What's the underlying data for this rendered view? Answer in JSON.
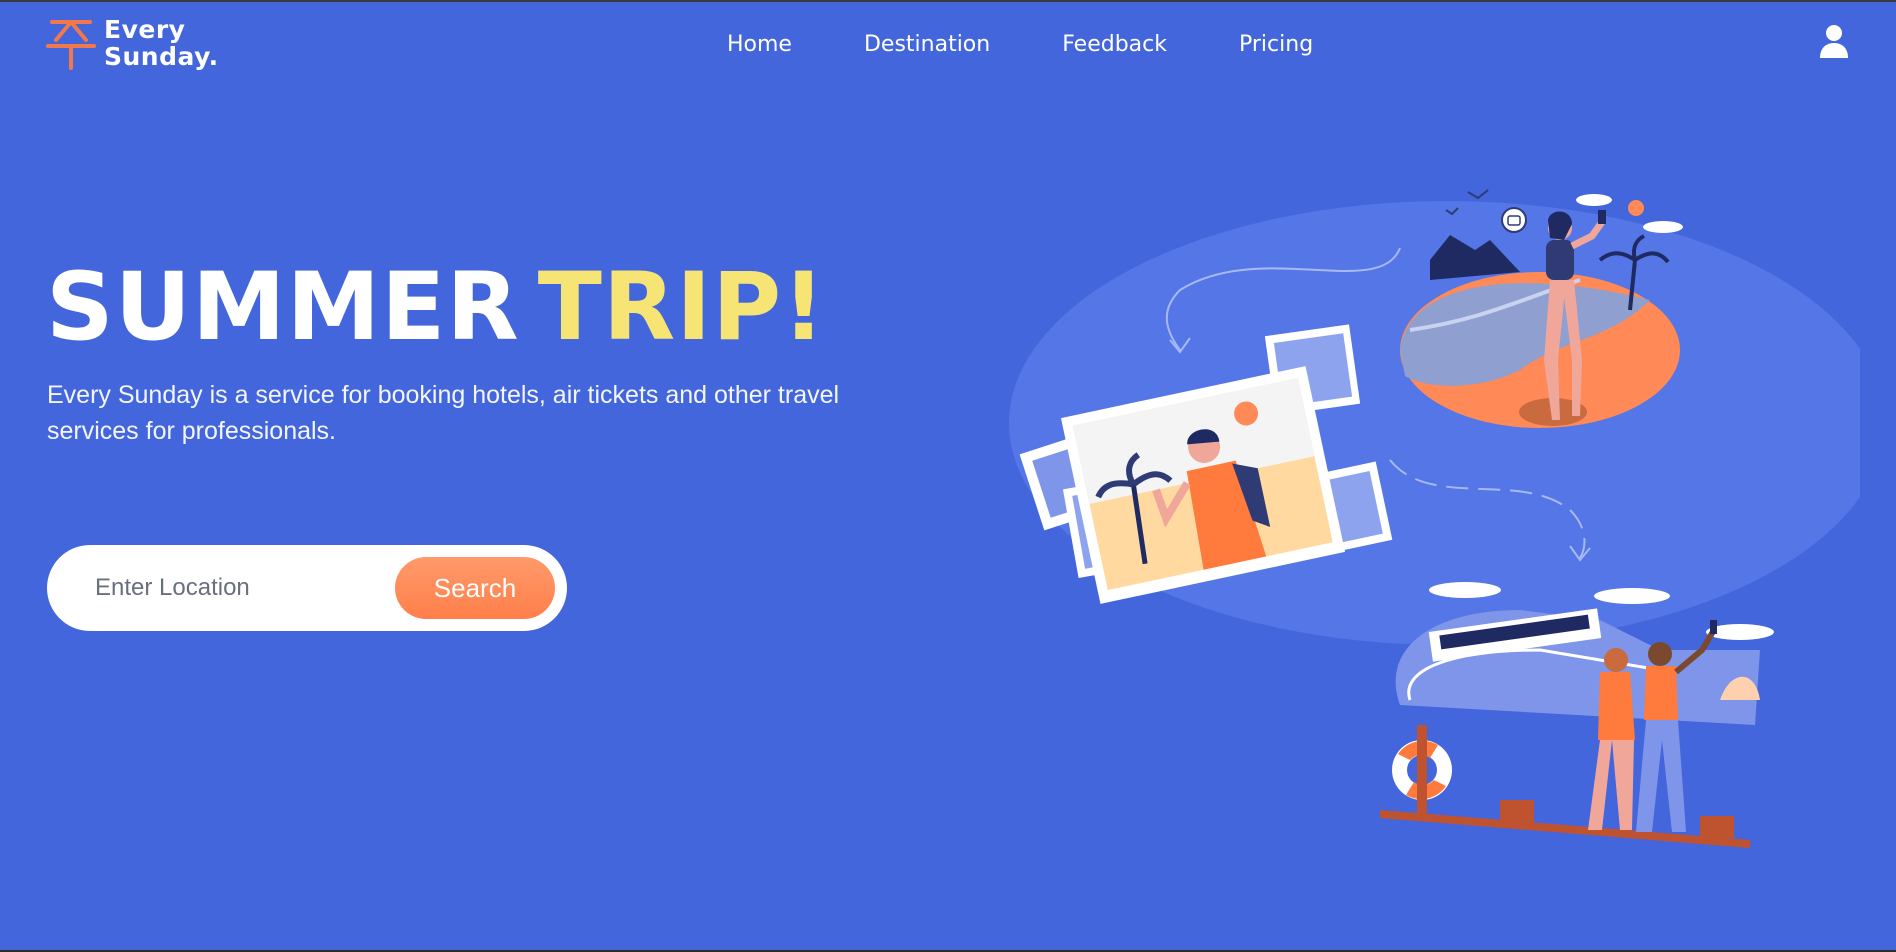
{
  "brand": {
    "name_line1": "Every",
    "name_line2": "Sunday.",
    "accent_color": "#f2784b"
  },
  "nav": {
    "items": [
      {
        "label": "Home"
      },
      {
        "label": "Destination"
      },
      {
        "label": "Feedback"
      },
      {
        "label": "Pricing"
      }
    ]
  },
  "header": {
    "user_icon": "user-icon"
  },
  "hero": {
    "title_word1": "SUMMER",
    "title_word2": "TRIP!",
    "title_highlight_color": "#f6e574",
    "description": "Every Sunday is a service for booking hotels, air tickets and other travel services for professionals."
  },
  "search": {
    "placeholder": "Enter Location",
    "value": "",
    "button_label": "Search"
  },
  "colors": {
    "background": "#4366dd",
    "button": "#ff8a57"
  }
}
